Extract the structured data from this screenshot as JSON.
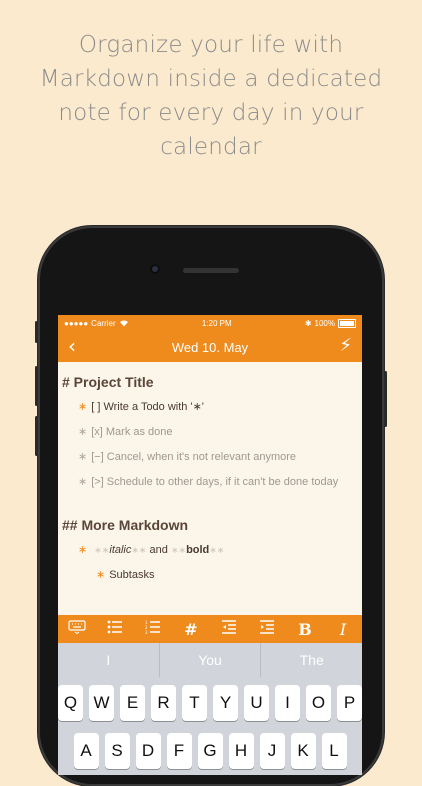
{
  "headline": {
    "line1": "Organize your life with",
    "line2": "Markdown inside a dedicated",
    "line3": "note for every day in your",
    "line4": "calendar"
  },
  "status": {
    "carrier": "Carrier",
    "time": "1:20 PM",
    "battery": "100%"
  },
  "nav": {
    "title": "Wed 10. May",
    "back_glyph": "‹",
    "action_glyph": "⚡"
  },
  "note": {
    "title": "# Project Title",
    "todos": [
      {
        "star": "∗",
        "text": "[ ] Write a Todo with '∗'"
      },
      {
        "star": "∗",
        "text": "[x] Mark as done"
      },
      {
        "star": "∗",
        "text": "[−] Cancel, when it's not relevant anymore"
      },
      {
        "star": "∗",
        "text": "[>] Schedule to other days, if it can't be done today"
      }
    ],
    "section2": "## More Markdown",
    "italic_marker": "∗∗",
    "italic_word": "italic",
    "and_word": "and",
    "bold_marker": "∗∗",
    "bold_word": "bold",
    "subtask": "Subtasks"
  },
  "toolbar": {
    "hash": "#",
    "bold": "B",
    "italic": "I"
  },
  "suggestions": [
    "I",
    "You",
    "The"
  ],
  "keyboard": {
    "row1": [
      "Q",
      "W",
      "E",
      "R",
      "T",
      "Y",
      "U",
      "I",
      "O",
      "P"
    ],
    "row2": [
      "A",
      "S",
      "D",
      "F",
      "G",
      "H",
      "J",
      "K",
      "L"
    ]
  },
  "colors": {
    "accent": "#ef8b1d",
    "background": "#fbeacd",
    "note_bg": "#fbf5ea"
  }
}
